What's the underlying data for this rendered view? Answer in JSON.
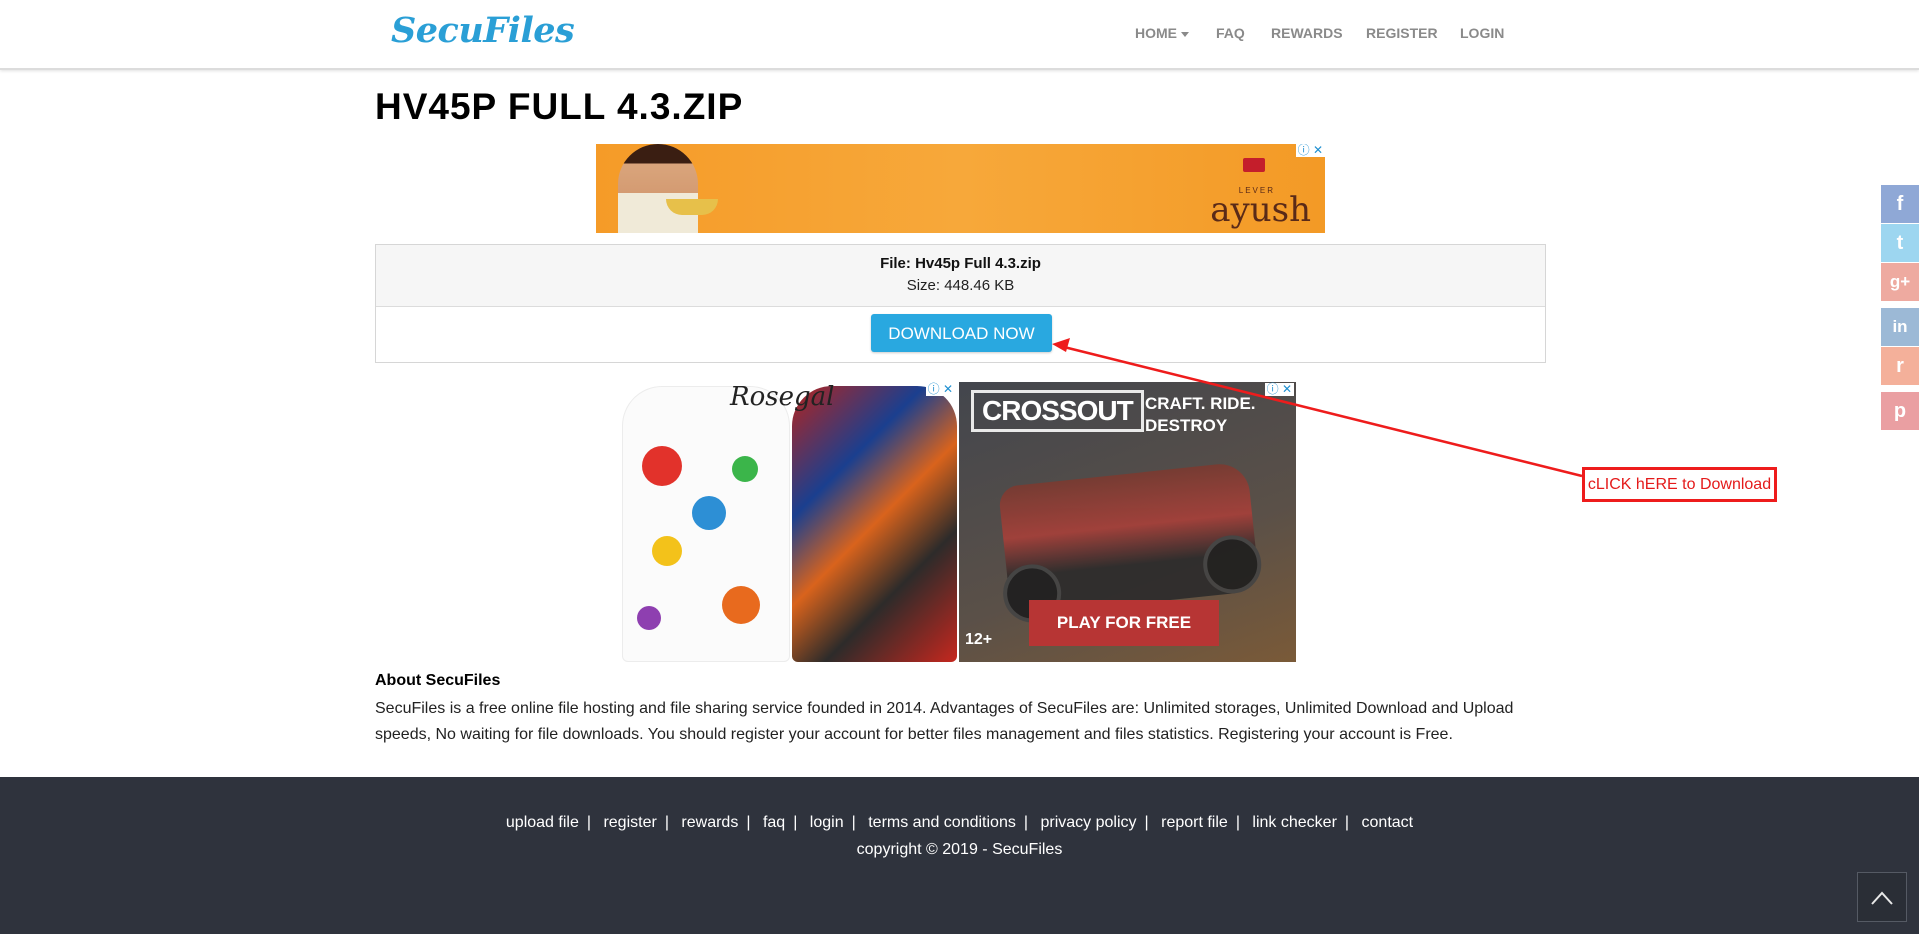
{
  "header": {
    "logo": "SecuFiles",
    "nav": [
      {
        "label": "HOME",
        "dropdown": true
      },
      {
        "label": "FAQ"
      },
      {
        "label": "REWARDS"
      },
      {
        "label": "REGISTER"
      },
      {
        "label": "LOGIN"
      }
    ]
  },
  "page_title": "HV45P FULL 4.3.ZIP",
  "ads": {
    "top_banner": {
      "brand": "ayush",
      "brand_prefix": "LEVER"
    },
    "fashion": {
      "brand": "Rosegal"
    },
    "game": {
      "title": "CROSSOUT",
      "tagline": "CRAFT. RIDE. DESTROY",
      "cta": "PLAY FOR FREE",
      "age": "12+"
    },
    "controls": "ⓘ ✕"
  },
  "file": {
    "name_label": "File: Hv45p Full 4.3.zip",
    "size_label": "Size: 448.46 KB",
    "download_button": "DOWNLOAD NOW"
  },
  "annotation": {
    "callout": "cLICK hERE to Download",
    "color": "#ee1c1c"
  },
  "about": {
    "heading": "About SecuFiles",
    "text": "SecuFiles is a free online file hosting and file sharing service founded in 2014. Advantages of SecuFiles are: Unlimited storages, Unlimited Download and Upload speeds, No waiting for file downloads. You should register your account for better files management and files statistics. Registering your account is Free."
  },
  "footer": {
    "links": [
      "upload file",
      "register",
      "rewards",
      "faq",
      "login",
      "terms and conditions",
      "privacy policy",
      "report file",
      "link checker",
      "contact"
    ],
    "separator": "|",
    "copyright": "copyright © 2019 - SecuFiles"
  },
  "share": [
    {
      "icon": "facebook-icon",
      "glyph": "f",
      "color": "#8fa8d6"
    },
    {
      "icon": "twitter-icon",
      "glyph": "t",
      "color": "#9dd6f0"
    },
    {
      "icon": "google-plus-icon",
      "glyph": "g+",
      "color": "#eeaaa0"
    },
    {
      "icon": "linkedin-icon",
      "glyph": "in",
      "color": "#9cb9d6"
    },
    {
      "icon": "reddit-icon",
      "glyph": "r",
      "color": "#f4b09a"
    },
    {
      "icon": "pinterest-icon",
      "glyph": "p",
      "color": "#ea9fa2"
    }
  ],
  "colors": {
    "accent": "#29a8e0",
    "footer_bg": "#2f333d"
  }
}
